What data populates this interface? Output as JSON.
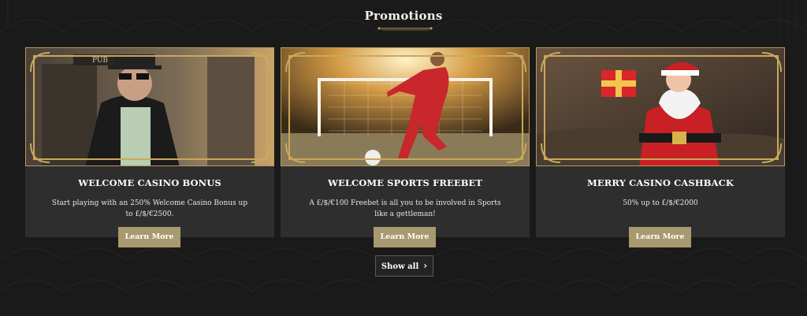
{
  "section": {
    "title": "Promotions"
  },
  "promotions": [
    {
      "title": "WELCOME CASINO BONUS",
      "description": "Start playing with an 250% Welcome Casino Bonus up to £/$/€2500.",
      "button_label": "Learn More",
      "image_label": "PUB"
    },
    {
      "title": "WELCOME SPORTS FREEBET",
      "description": "A £/$/€100 Freebet is all you to be involved in Sports like a gettleman!",
      "button_label": "Learn More"
    },
    {
      "title": "MERRY CASINO CASHBACK",
      "description": "50% up to £/$/€2000",
      "button_label": "Learn More"
    }
  ],
  "show_all": {
    "label": "Show all",
    "icon": "chevron-right-icon"
  },
  "colors": {
    "background": "#1a1a1a",
    "card": "#2e2e2e",
    "button": "#a89a6f",
    "gold_frame": "#b89a58"
  }
}
